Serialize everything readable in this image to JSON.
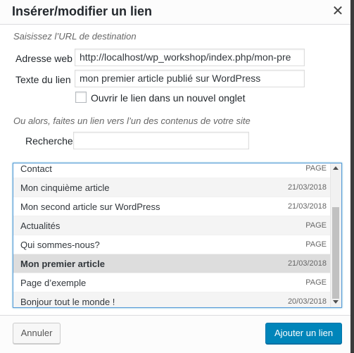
{
  "dialog": {
    "title": "Insérer/modifier un lien",
    "close_icon": "close-icon"
  },
  "url_section": {
    "hint": "Saisissez l’URL de destination",
    "url_label": "Adresse web",
    "url_value": "http://localhost/wp_workshop/index.php/mon-pre",
    "text_label": "Texte du lien",
    "text_value": "mon premier article publié sur WordPress",
    "new_tab_label": "Ouvrir le lien dans un nouvel onglet"
  },
  "link_search": {
    "hint": "Ou alors, faites un lien vers l’un des contenus de votre site",
    "search_label": "Recherche",
    "search_value": ""
  },
  "results": [
    {
      "title": "Contact",
      "info": "PAGE"
    },
    {
      "title": "Mon cinquième article",
      "info": "21/03/2018"
    },
    {
      "title": "Mon second article sur WordPress",
      "info": "21/03/2018"
    },
    {
      "title": "Actualités",
      "info": "PAGE"
    },
    {
      "title": "Qui sommes-nous?",
      "info": "PAGE"
    },
    {
      "title": "Mon premier article",
      "info": "21/03/2018",
      "selected": true
    },
    {
      "title": "Page d’exemple",
      "info": "PAGE"
    },
    {
      "title": "Bonjour tout le monde !",
      "info": "20/03/2018"
    }
  ],
  "footer": {
    "cancel_label": "Annuler",
    "submit_label": "Ajouter un lien"
  },
  "colors": {
    "primary": "#0085ba",
    "selected_row": "#dddddd",
    "focus_border": "#5b9dd9"
  }
}
